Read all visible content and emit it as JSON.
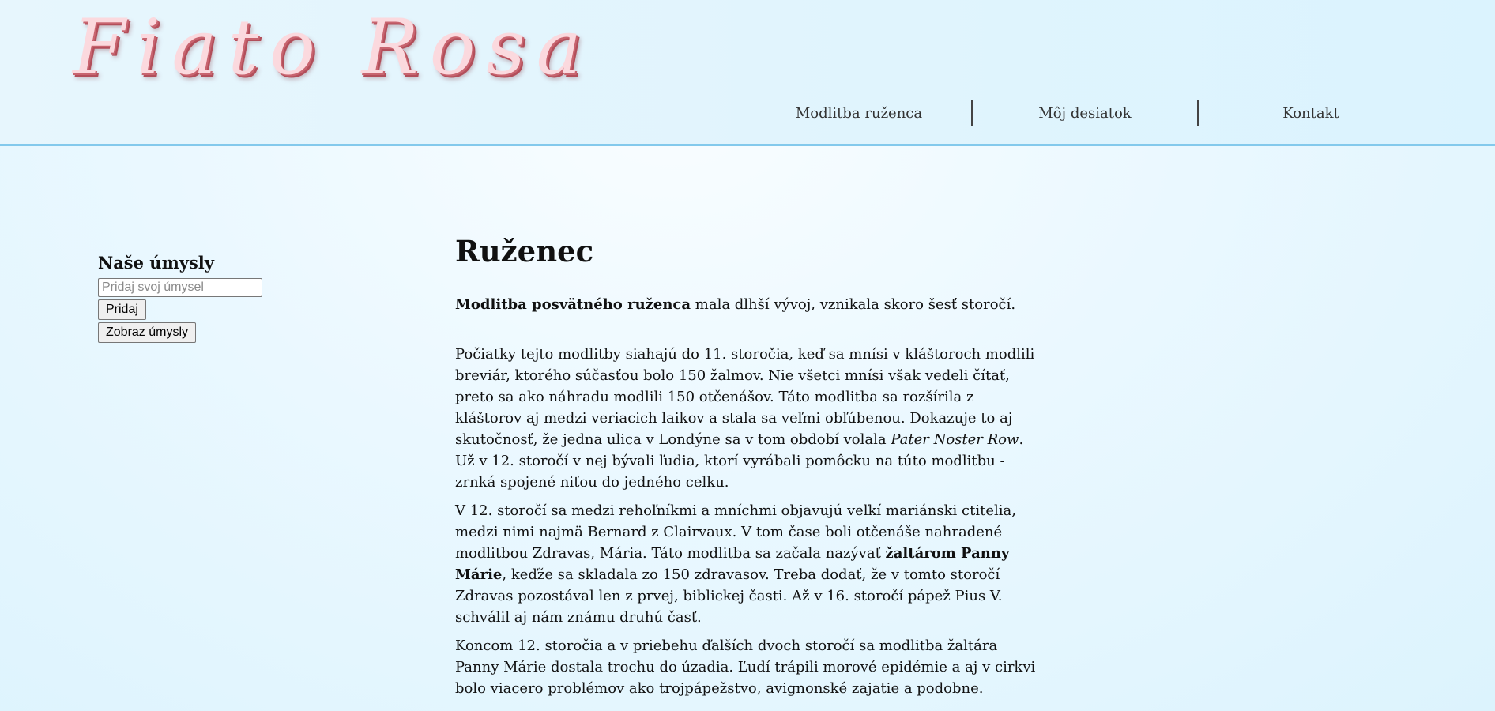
{
  "header": {
    "logo_text": "Fiato Rosa",
    "nav": [
      {
        "label": "Modlitba ruženca"
      },
      {
        "label": "Môj desiatok"
      },
      {
        "label": "Kontakt"
      }
    ]
  },
  "sidebar": {
    "title": "Naše úmysly",
    "input_placeholder": "Pridaj svoj úmysel",
    "add_button": "Pridaj",
    "show_button": "Zobraz úmysly"
  },
  "main": {
    "title": "Ruženec",
    "p1": {
      "bold": "Modlitba posvätného ruženca",
      "rest": " mala dlhší vývoj, vznikala skoro šesť storočí."
    },
    "p2": {
      "part1": "Počiatky tejto modlitby siahajú do 11. storočia, keď sa mnísi v kláštoroch modlili breviár, ktorého súčasťou bolo 150 žalmov. Nie všetci mnísi však vedeli čítať, preto sa ako náhradu modlili 150 otčenášov. Táto modlitba sa rozšírila z kláštorov aj medzi veriacich laikov a stala sa veľmi obľúbenou. Dokazuje to aj skutočnosť, že jedna ulica v Londýne sa v tom období volala ",
      "italic": "Pater Noster Row",
      "part2": ". Už v 12. storočí v nej bývali ľudia, ktorí vyrábali pomôcku na túto modlitbu - zrnká spojené niťou do jedného celku."
    },
    "p3": {
      "part1": "V 12. storočí sa medzi rehoľníkmi a mníchmi objavujú veľkí mariánski ctitelia, medzi nimi najmä Bernard z Clairvaux. V tom čase boli otčenáše nahradené modlitbou Zdravas, Mária. Táto modlitba sa začala nazývať ",
      "bold": "žaltárom Panny Márie",
      "part2": ", keďže sa skladala zo 150 zdravasov. Treba dodať, že v tomto storočí Zdravas pozostával len z prvej, biblickej časti. Až v 16. storočí pápež Pius V. schválil aj nám známu druhú časť."
    },
    "p4": {
      "text": "Koncom 12. storočia a v priebehu ďalších dvoch storočí sa modlitba žaltára Panny Márie dostala trochu do úzadia. Ľudí trápili morové epidémie a aj v cirkvi bolo viacero problémov ako trojpápežstvo, avignonské zajatie a podobne."
    }
  },
  "colors": {
    "header_border": "#83c9ec",
    "logo_fill": "#fbd9de",
    "logo_shadow": "#b24e5a"
  }
}
